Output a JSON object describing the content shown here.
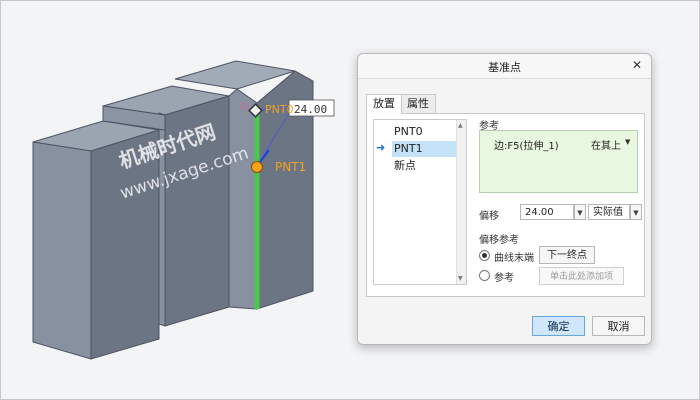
{
  "viewport": {
    "watermark_line1": "机械时代网",
    "watermark_line2": "www.jxage.com",
    "point_tag_label": "PNT0",
    "point_dim_value": "24.00",
    "pnt1_label": "PNT1",
    "colors": {
      "edge_green": "#47c847",
      "point_orange": "#f2a31a",
      "block_front": "#7d8796",
      "block_top": "#9aa3b0",
      "block_side": "#6f7886"
    }
  },
  "dialog": {
    "title": "基准点",
    "close_icon": "close-icon",
    "tabs": [
      "放置",
      "属性"
    ],
    "active_tab": 0,
    "points": {
      "items": [
        "PNT0",
        "PNT1",
        "新点"
      ],
      "selected_index": 1
    },
    "reference": {
      "label": "参考",
      "item": "边:F5(拉伸_1)",
      "mode": "在其上"
    },
    "offset": {
      "label": "偏移",
      "value": "24.00",
      "type": "实际值"
    },
    "offset_reference": {
      "label": "偏移参考",
      "options": [
        {
          "label": "曲线末端",
          "button": "下一终点",
          "selected": true
        },
        {
          "label": "参考",
          "button": "单击此处添加项",
          "selected": false
        }
      ]
    },
    "ok_label": "确定",
    "cancel_label": "取消"
  }
}
